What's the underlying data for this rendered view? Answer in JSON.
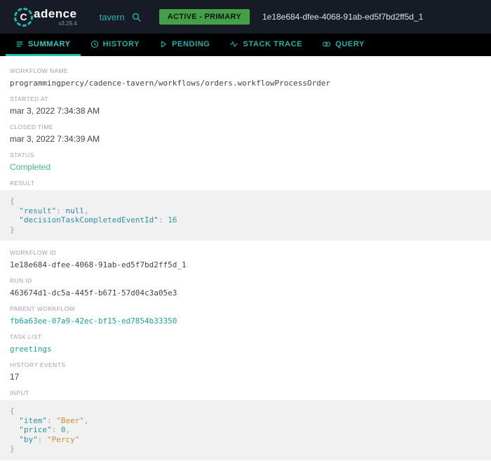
{
  "header": {
    "logo_letter": "C",
    "brand_rest": "adence",
    "version": "v3.29.4",
    "domain": "tavern",
    "badge": "ACTIVE - PRIMARY",
    "workflow_id": "1e18e684-dfee-4068-91ab-ed5f7bd2ff5d_1"
  },
  "tabs": [
    {
      "label": "SUMMARY",
      "active": true
    },
    {
      "label": "HISTORY",
      "active": false
    },
    {
      "label": "PENDING",
      "active": false
    },
    {
      "label": "STACK TRACE",
      "active": false
    },
    {
      "label": "QUERY",
      "active": false
    }
  ],
  "summary": {
    "workflow_name": {
      "label": "WORKFLOW NAME",
      "value": "programmingpercy/cadence-tavern/workflows/orders.workflowProcessOrder"
    },
    "started_at": {
      "label": "STARTED AT",
      "value": "mar 3, 2022 7:34:38 AM"
    },
    "closed_time": {
      "label": "CLOSED TIME",
      "value": "mar 3, 2022 7:34:39 AM"
    },
    "status": {
      "label": "STATUS",
      "value": "Completed"
    },
    "result": {
      "label": "RESULT"
    },
    "workflow_id": {
      "label": "WORKFLOW ID",
      "value": "1e18e684-dfee-4068-91ab-ed5f7bd2ff5d_1"
    },
    "run_id": {
      "label": "RUN ID",
      "value": "463674d1-dc5a-445f-b671-57d04c3a05e3"
    },
    "parent_workflow": {
      "label": "PARENT WORKFLOW",
      "value": "fb6a63ee-07a9-42ec-bf15-ed7854b33350"
    },
    "task_list": {
      "label": "TASK LIST",
      "value": "greetings"
    },
    "history_events": {
      "label": "HISTORY EVENTS",
      "value": "17"
    },
    "input": {
      "label": "INPUT"
    }
  },
  "code_blocks": {
    "result": {
      "lines": [
        [
          {
            "t": "{",
            "c": "punct"
          }
        ],
        [
          {
            "t": "  ",
            "c": "plain"
          },
          {
            "t": "\"result\"",
            "c": "key"
          },
          {
            "t": ": ",
            "c": "punct"
          },
          {
            "t": "null",
            "c": "null"
          },
          {
            "t": ",",
            "c": "punct"
          }
        ],
        [
          {
            "t": "  ",
            "c": "plain"
          },
          {
            "t": "\"decisionTaskCompletedEventId\"",
            "c": "key"
          },
          {
            "t": ": ",
            "c": "punct"
          },
          {
            "t": "16",
            "c": "number"
          }
        ],
        [
          {
            "t": "}",
            "c": "punct"
          }
        ]
      ]
    },
    "input": {
      "lines": [
        [
          {
            "t": "{",
            "c": "punct"
          }
        ],
        [
          {
            "t": "  ",
            "c": "plain"
          },
          {
            "t": "\"item\"",
            "c": "key"
          },
          {
            "t": ": ",
            "c": "punct"
          },
          {
            "t": "\"Beer\"",
            "c": "string"
          },
          {
            "t": ",",
            "c": "punct"
          }
        ],
        [
          {
            "t": "  ",
            "c": "plain"
          },
          {
            "t": "\"price\"",
            "c": "key"
          },
          {
            "t": ": ",
            "c": "punct"
          },
          {
            "t": "0",
            "c": "number"
          },
          {
            "t": ",",
            "c": "punct"
          }
        ],
        [
          {
            "t": "  ",
            "c": "plain"
          },
          {
            "t": "\"by\"",
            "c": "key"
          },
          {
            "t": ": ",
            "c": "punct"
          },
          {
            "t": "\"Percy\"",
            "c": "string"
          }
        ],
        [
          {
            "t": "}",
            "c": "punct"
          }
        ]
      ]
    }
  }
}
